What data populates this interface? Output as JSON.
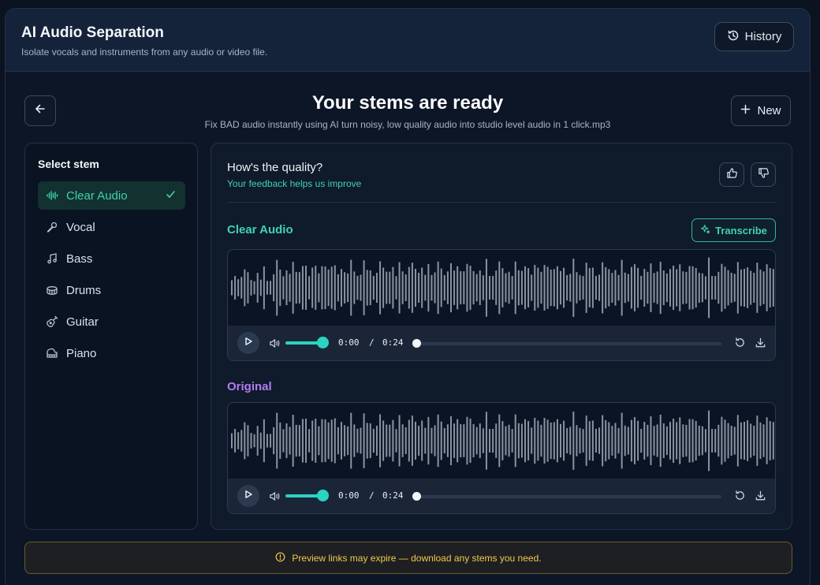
{
  "header": {
    "title": "AI Audio Separation",
    "subtitle": "Isolate vocals and instruments from any audio or video file.",
    "history_label": "History"
  },
  "result": {
    "title": "Your stems are ready",
    "filename": "Fix BAD audio instantly using AI turn noisy, low quality audio into studio level audio in 1 click.mp3",
    "new_label": "New"
  },
  "stems": {
    "title": "Select stem",
    "items": [
      {
        "label": "Clear Audio",
        "icon": "waveform-icon",
        "active": true
      },
      {
        "label": "Vocal",
        "icon": "microphone-icon",
        "active": false
      },
      {
        "label": "Bass",
        "icon": "music-note-icon",
        "active": false
      },
      {
        "label": "Drums",
        "icon": "drum-icon",
        "active": false
      },
      {
        "label": "Guitar",
        "icon": "guitar-icon",
        "active": false
      },
      {
        "label": "Piano",
        "icon": "piano-icon",
        "active": false
      }
    ]
  },
  "feedback": {
    "question": "How's the quality?",
    "subtitle": "Your feedback helps us improve"
  },
  "players": [
    {
      "label": "Clear Audio",
      "label_color": "#3fd3b0",
      "current": "0:00",
      "separator": "/",
      "duration": "0:24",
      "volume": 1.0,
      "progress": 0.0
    },
    {
      "label": "Original",
      "label_color": "#b07cf0",
      "current": "0:00",
      "separator": "/",
      "duration": "0:24",
      "volume": 1.0,
      "progress": 0.0
    }
  ],
  "transcribe_label": "Transcribe",
  "notice": {
    "text": "Preview links may expire — download any stems you need."
  },
  "colors": {
    "accent": "#3fd3b0",
    "original": "#b07cf0",
    "warning": "#f2c94c"
  }
}
